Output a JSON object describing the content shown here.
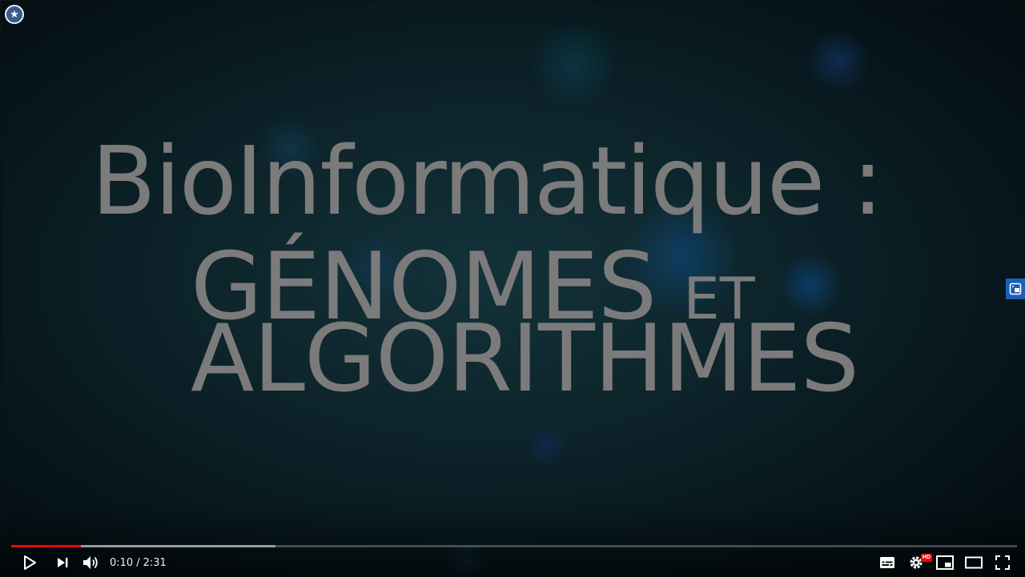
{
  "video": {
    "title_line1": "BioInformatique :",
    "title_line2_main": "GÉNOMES",
    "title_line2_small": "ET",
    "title_line3": "ALGORITHMES"
  },
  "player": {
    "current_time": "0:10",
    "time_separator": "/",
    "duration": "2:31",
    "played_fraction": 0.069,
    "buffered_fraction": 0.263,
    "quality_badge": "HD",
    "progress_color": "#ff0000"
  },
  "icons": {
    "top_left": "star-badge-icon",
    "side_tab": "extension-icon",
    "play": "play-icon",
    "next": "next-icon",
    "volume": "volume-icon",
    "subtitles": "subtitles-icon",
    "settings": "gear-icon",
    "miniplayer": "miniplayer-icon",
    "theater": "theater-mode-icon",
    "fullscreen": "fullscreen-icon"
  }
}
